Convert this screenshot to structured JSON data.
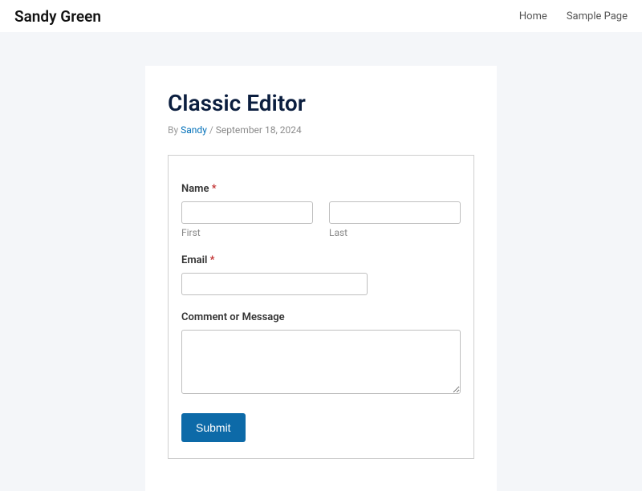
{
  "header": {
    "site_title": "Sandy Green",
    "nav": {
      "home": "Home",
      "sample": "Sample Page"
    }
  },
  "post": {
    "title": "Classic Editor",
    "by_label": "By ",
    "author": "Sandy",
    "sep": " / ",
    "date": "September 18, 2024"
  },
  "form": {
    "name_label": "Name ",
    "name_required": "*",
    "first_sub": "First",
    "last_sub": "Last",
    "email_label": "Email ",
    "email_required": "*",
    "comment_label": "Comment or Message",
    "submit_label": "Submit"
  }
}
